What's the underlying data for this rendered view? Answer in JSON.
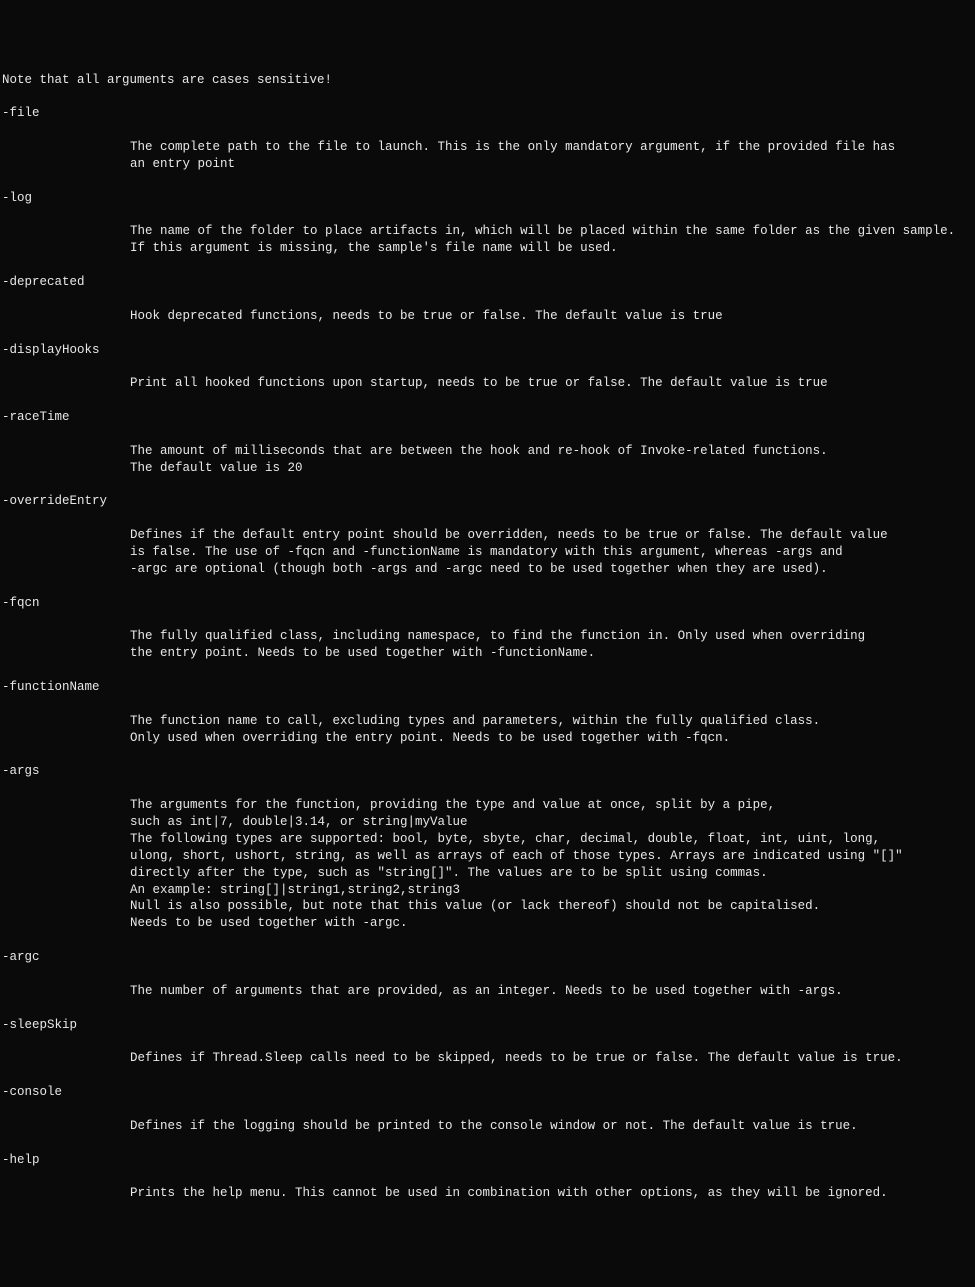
{
  "header": "Note that all arguments are cases sensitive!",
  "args": {
    "file": {
      "name": "-file",
      "desc": "The complete path to the file to launch. This is the only mandatory argument, if the provided file has\nan entry point"
    },
    "log": {
      "name": "-log",
      "desc": "The name of the folder to place artifacts in, which will be placed within the same folder as the given sample.\nIf this argument is missing, the sample's file name will be used."
    },
    "deprecated": {
      "name": "-deprecated",
      "desc": "Hook deprecated functions, needs to be true or false. The default value is true"
    },
    "displayHooks": {
      "name": "-displayHooks",
      "desc": "Print all hooked functions upon startup, needs to be true or false. The default value is true"
    },
    "raceTime": {
      "name": "-raceTime",
      "desc": "The amount of milliseconds that are between the hook and re-hook of Invoke-related functions.\nThe default value is 20"
    },
    "overrideEntry": {
      "name": "-overrideEntry",
      "desc": "Defines if the default entry point should be overridden, needs to be true or false. The default value\nis false. The use of -fqcn and -functionName is mandatory with this argument, whereas -args and\n-argc are optional (though both -args and -argc need to be used together when they are used)."
    },
    "fqcn": {
      "name": "-fqcn",
      "desc": "The fully qualified class, including namespace, to find the function in. Only used when overriding\nthe entry point. Needs to be used together with -functionName."
    },
    "functionName": {
      "name": "-functionName",
      "desc": "The function name to call, excluding types and parameters, within the fully qualified class.\nOnly used when overriding the entry point. Needs to be used together with -fqcn."
    },
    "argsParam": {
      "name": "-args",
      "desc": "The arguments for the function, providing the type and value at once, split by a pipe,\nsuch as int|7, double|3.14, or string|myValue\nThe following types are supported: bool, byte, sbyte, char, decimal, double, float, int, uint, long,\nulong, short, ushort, string, as well as arrays of each of those types. Arrays are indicated using \"[]\"\ndirectly after the type, such as \"string[]\". The values are to be split using commas.\nAn example: string[]|string1,string2,string3\nNull is also possible, but note that this value (or lack thereof) should not be capitalised.\nNeeds to be used together with -argc."
    },
    "argc": {
      "name": "-argc",
      "desc": "The number of arguments that are provided, as an integer. Needs to be used together with -args."
    },
    "sleepSkip": {
      "name": "-sleepSkip",
      "desc": "Defines if Thread.Sleep calls need to be skipped, needs to be true or false. The default value is true."
    },
    "console": {
      "name": "-console",
      "desc": "Defines if the logging should be printed to the console window or not. The default value is true."
    },
    "help": {
      "name": "-help",
      "desc": "Prints the help menu. This cannot be used in combination with other options, as they will be ignored."
    }
  }
}
